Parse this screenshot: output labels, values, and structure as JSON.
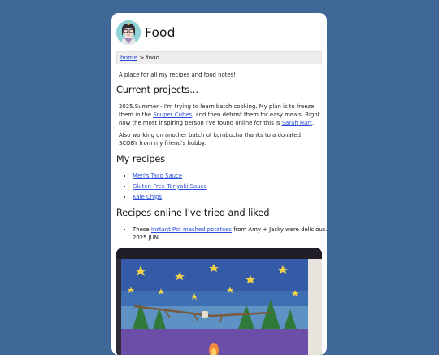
{
  "site": {
    "title": "Food",
    "avatar": "avatar-illustration"
  },
  "breadcrumb": {
    "home": "home",
    "separator": ">",
    "current": "food"
  },
  "intro": "A place for all my recipes and food notes!",
  "current_projects": {
    "heading": "Current projects...",
    "para1": {
      "t1": "2025.Summer - I'm trying to learn batch cooking. My plan is to freeze them in the ",
      "link1": "Souper Cubes",
      "t2": ", and then defrost them for easy meals. Right now the most inspiring person I've found online for this is ",
      "link2": "Sarah Hart",
      "t3": "."
    },
    "para2": "Also working on another batch of kombucha thanks to a donated SCOBY from my friend's hubby."
  },
  "my_recipes": {
    "heading": "My recipes",
    "items": [
      "Meri's Taco Sauce",
      "Gluten-Free Teriyaki Sauce",
      "Kale Chips"
    ]
  },
  "recipes_online": {
    "heading": "Recipes online I've tried and liked",
    "item": {
      "t1": "These ",
      "link": "Instant Pot mashed potatoes",
      "t2": " from Amy + Jacky were delicious. 2025.JUN"
    }
  },
  "photo": {
    "subject": "watercolor-painting-night-sky-pine-trees"
  },
  "colors": {
    "background": "#3f6896",
    "link": "#2a4fd6",
    "card": "#ffffff"
  }
}
